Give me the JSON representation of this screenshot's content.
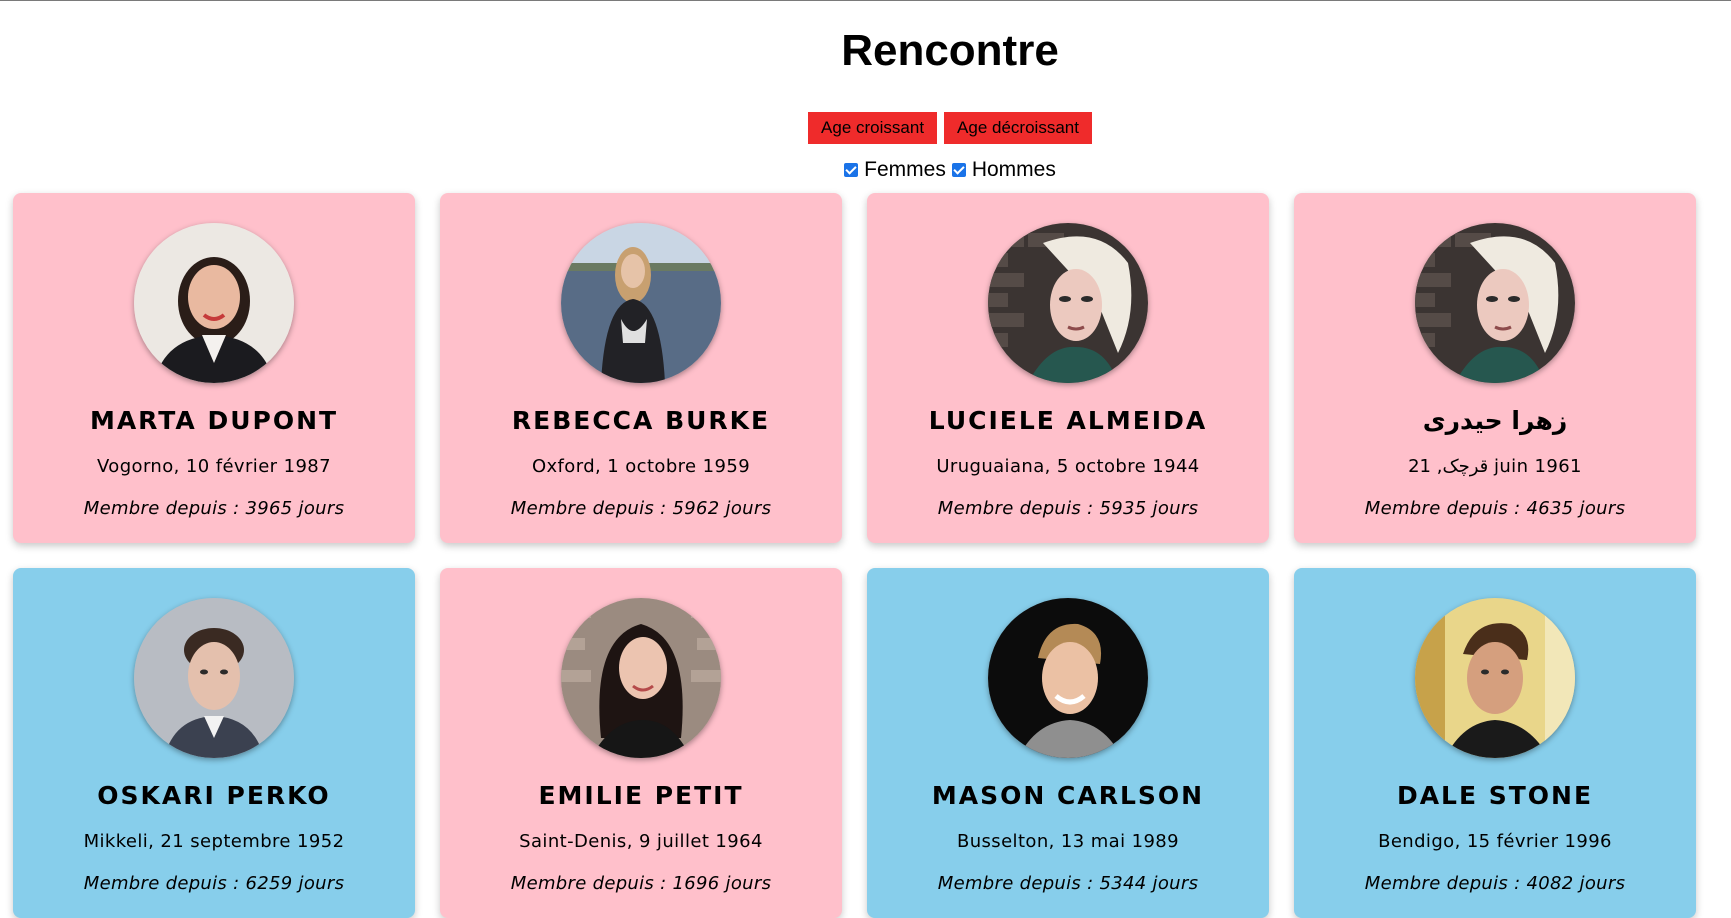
{
  "page": {
    "title": "Rencontre"
  },
  "sort": {
    "asc_label": "Age croissant",
    "desc_label": "Age décroissant"
  },
  "filters": {
    "women_label": "Femmes",
    "women_checked": true,
    "men_label": "Hommes",
    "men_checked": true
  },
  "colors": {
    "female_card": "#ffc0cb",
    "male_card": "#87ceeb",
    "button": "#ef2b2b"
  },
  "profiles": [
    {
      "name": "MARTA DUPONT",
      "birth": "Vogorno, 10 février 1987",
      "member": "Membre depuis : 3965 jours",
      "gender": "female",
      "avatar": "woman-dark-hair-blazer-photo"
    },
    {
      "name": "REBECCA BURKE",
      "birth": "Oxford, 1 octobre 1959",
      "member": "Membre depuis : 5962 jours",
      "gender": "female",
      "avatar": "woman-blonde-riverside-photo"
    },
    {
      "name": "LUCIELE ALMEIDA",
      "birth": "Uruguaiana, 5 octobre 1944",
      "member": "Membre depuis : 5935 jours",
      "gender": "female",
      "avatar": "woman-platinum-hair-brick-wall-photo"
    },
    {
      "name": "زهرا حیدری",
      "birth": "21 ,قرچک juin 1961",
      "member": "Membre depuis : 4635 jours",
      "gender": "female",
      "avatar": "woman-platinum-hair-brick-wall-photo"
    },
    {
      "name": "OSKARI PERKO",
      "birth": "Mikkeli, 21 septembre 1952",
      "member": "Membre depuis : 6259 jours",
      "gender": "male",
      "avatar": "man-suit-grey-background-photo"
    },
    {
      "name": "EMILIE PETIT",
      "birth": "Saint-Denis, 9 juillet 1964",
      "member": "Membre depuis : 1696 jours",
      "gender": "female",
      "avatar": "woman-long-dark-hair-brick-photo"
    },
    {
      "name": "MASON CARLSON",
      "birth": "Busselton, 13 mai 1989",
      "member": "Membre depuis : 5344 jours",
      "gender": "male",
      "avatar": "man-smiling-black-background-photo"
    },
    {
      "name": "DALE STONE",
      "birth": "Bendigo, 15 février 1996",
      "member": "Membre depuis : 4082 jours",
      "gender": "male",
      "avatar": "man-yellow-background-photo"
    }
  ]
}
